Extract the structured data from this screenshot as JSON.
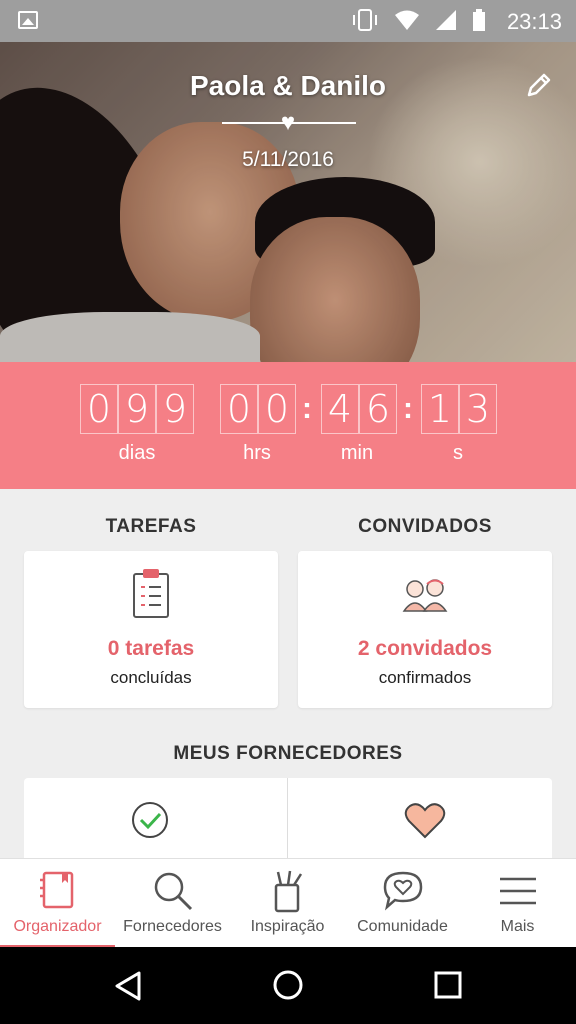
{
  "status_bar": {
    "time": "23:13"
  },
  "hero": {
    "couple_names": "Paola & Danilo",
    "wedding_date": "5/11/2016"
  },
  "countdown": {
    "days_digits": [
      "0",
      "9",
      "9"
    ],
    "hours_digits": [
      "0",
      "0"
    ],
    "minutes_digits": [
      "4",
      "6"
    ],
    "seconds_digits": [
      "1",
      "3"
    ],
    "labels": {
      "days": "dias",
      "hours": "hrs",
      "minutes": "min",
      "seconds": "s"
    }
  },
  "tasks": {
    "title": "TAREFAS",
    "count_label": "0 tarefas",
    "status_label": "concluídas"
  },
  "guests": {
    "title": "CONVIDADOS",
    "count_label": "2 convidados",
    "status_label": "confirmados"
  },
  "suppliers": {
    "title": "MEUS FORNECEDORES"
  },
  "bottom_nav": [
    {
      "label": "Organizador",
      "icon": "notebook-icon",
      "active": true
    },
    {
      "label": "Fornecedores",
      "icon": "search-icon",
      "active": false
    },
    {
      "label": "Inspiração",
      "icon": "cup-pencils-icon",
      "active": false
    },
    {
      "label": "Comunidade",
      "icon": "chat-heart-icon",
      "active": false
    },
    {
      "label": "Mais",
      "icon": "menu-icon",
      "active": false
    }
  ],
  "colors": {
    "accent": "#f57f86",
    "accent_text": "#e4636b",
    "background": "#eeeeee"
  }
}
